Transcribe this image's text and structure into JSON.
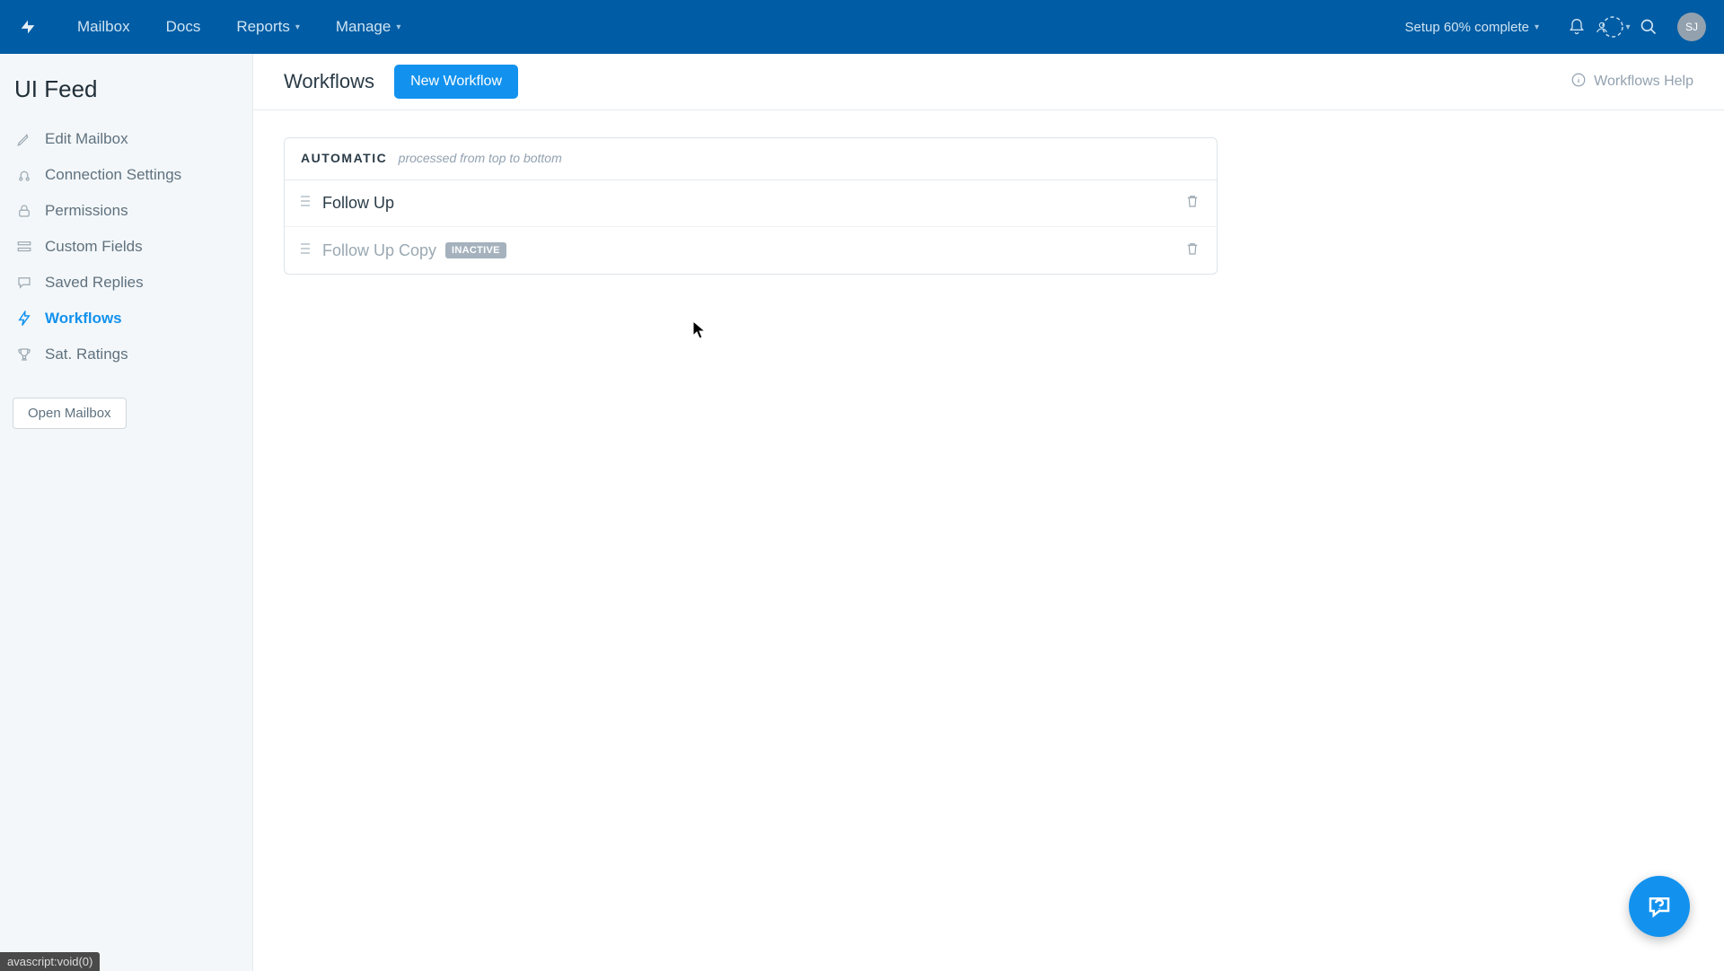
{
  "topnav": {
    "items": [
      "Mailbox",
      "Docs",
      "Reports",
      "Manage"
    ],
    "setup": "Setup 60% complete",
    "avatar": "SJ"
  },
  "sidebar": {
    "title": "UI Feed",
    "items": [
      {
        "label": "Edit Mailbox"
      },
      {
        "label": "Connection Settings"
      },
      {
        "label": "Permissions"
      },
      {
        "label": "Custom Fields"
      },
      {
        "label": "Saved Replies"
      },
      {
        "label": "Workflows"
      },
      {
        "label": "Sat. Ratings"
      }
    ],
    "open_btn": "Open Mailbox"
  },
  "main": {
    "title": "Workflows",
    "new_btn": "New Workflow",
    "help": "Workflows Help"
  },
  "card": {
    "auto_label": "AUTOMATIC",
    "auto_hint": "processed from top to bottom",
    "rows": [
      {
        "name": "Follow Up"
      },
      {
        "name": "Follow Up Copy",
        "badge": "INACTIVE"
      }
    ]
  },
  "status": "avascript:void(0)"
}
